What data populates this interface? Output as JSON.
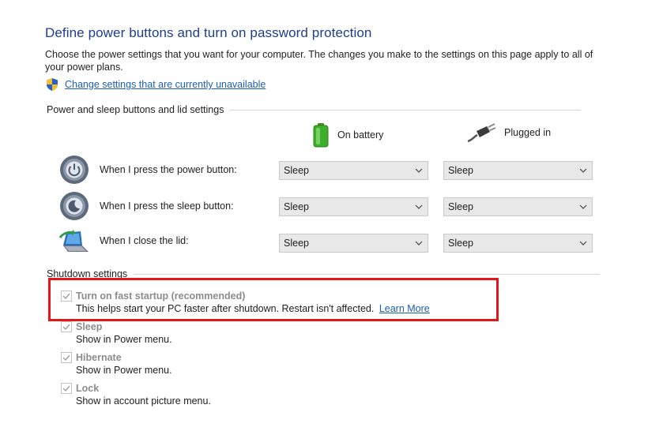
{
  "page": {
    "title": "Define power buttons and turn on password protection",
    "description": "Choose the power settings that you want for your computer. The changes you make to the settings on this page apply to all of your power plans.",
    "change_link": "Change settings that are currently unavailable"
  },
  "power_section": {
    "heading": "Power and sleep buttons and lid settings",
    "col_battery": "On battery",
    "col_plugged": "Plugged in",
    "rows": [
      {
        "label": "When I press the power button:",
        "battery": "Sleep",
        "plugged": "Sleep",
        "icon": "power-button-icon"
      },
      {
        "label": "When I press the sleep button:",
        "battery": "Sleep",
        "plugged": "Sleep",
        "icon": "sleep-button-icon"
      },
      {
        "label": "When I close the lid:",
        "battery": "Sleep",
        "plugged": "Sleep",
        "icon": "laptop-lid-icon"
      }
    ]
  },
  "shutdown_section": {
    "heading": "Shutdown settings",
    "options": [
      {
        "title": "Turn on fast startup (recommended)",
        "desc": "This helps start your PC faster after shutdown. Restart isn't affected.",
        "link": "Learn More",
        "checked": true
      },
      {
        "title": "Sleep",
        "desc": "Show in Power menu.",
        "checked": true
      },
      {
        "title": "Hibernate",
        "desc": "Show in Power menu.",
        "checked": true
      },
      {
        "title": "Lock",
        "desc": "Show in account picture menu.",
        "checked": true
      }
    ]
  },
  "colors": {
    "title": "#1e3e8c",
    "link": "#1c5fb0",
    "highlight": "#e3161c"
  }
}
